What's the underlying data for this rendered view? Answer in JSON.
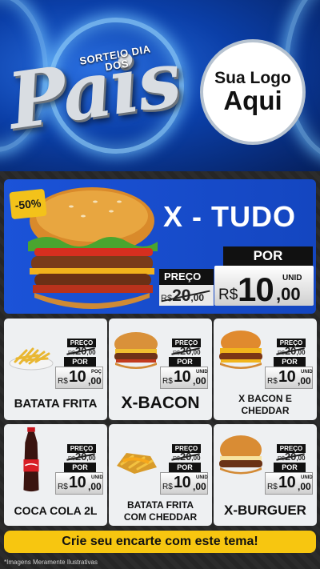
{
  "header": {
    "title_small": "SORTEIO DIA DOS",
    "title_big": "Pais",
    "logo_line1": "Sua Logo",
    "logo_line2": "Aqui"
  },
  "featured": {
    "discount": "-50%",
    "name": "X - TUDO",
    "preco_label": "PREÇO",
    "old_currency": "R$",
    "old_int": "20",
    "old_cents": ",00",
    "por_label": "POR",
    "unit": "UNID",
    "currency": "R$",
    "price_int": "10",
    "price_cents": ",00"
  },
  "products": [
    {
      "name": "BATATA FRITA",
      "preco_label": "PREÇO",
      "old_currency": "R$",
      "old_int": "20",
      "old_cents": ",00",
      "por_label": "POR",
      "unit": "POÇ",
      "currency": "R$",
      "price_int": "10",
      "price_cents": ",00"
    },
    {
      "name": "X-BACON",
      "preco_label": "PREÇO",
      "old_currency": "R$",
      "old_int": "20",
      "old_cents": ",00",
      "por_label": "POR",
      "unit": "UNID",
      "currency": "R$",
      "price_int": "10",
      "price_cents": ",00"
    },
    {
      "name": "X BACON E CHEDDAR",
      "preco_label": "PREÇO",
      "old_currency": "R$",
      "old_int": "20",
      "old_cents": ",00",
      "por_label": "POR",
      "unit": "UNID",
      "currency": "R$",
      "price_int": "10",
      "price_cents": ",00"
    },
    {
      "name": "COCA COLA 2L",
      "preco_label": "PREÇO",
      "old_currency": "R$",
      "old_int": "20",
      "old_cents": ",00",
      "por_label": "POR",
      "unit": "UNID",
      "currency": "R$",
      "price_int": "10",
      "price_cents": ",00"
    },
    {
      "name": "BATATA FRITA COM CHEDDAR",
      "preco_label": "PREÇO",
      "old_currency": "R$",
      "old_int": "20",
      "old_cents": ",00",
      "por_label": "POR",
      "unit": "UNID",
      "currency": "R$",
      "price_int": "10",
      "price_cents": ",00"
    },
    {
      "name": "X-BURGUER",
      "preco_label": "PREÇO",
      "old_currency": "R$",
      "old_int": "20",
      "old_cents": ",00",
      "por_label": "POR",
      "unit": "UNID",
      "currency": "R$",
      "price_int": "10",
      "price_cents": ",00"
    }
  ],
  "cta": "Crie seu encarte com este tema!",
  "footnote": "*Imagens Meramente Ilustrativas",
  "colors": {
    "accent_yellow": "#f7c610",
    "featured_blue": "#1b53d8",
    "header_blue": "#0b3fa8"
  }
}
